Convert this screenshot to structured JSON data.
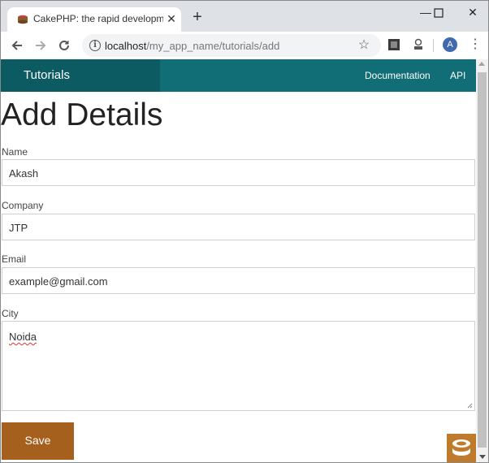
{
  "browser": {
    "tab_title": "CakePHP: the rapid development",
    "url_host": "localhost",
    "url_path": "/my_app_name/tutorials/add",
    "profile_initial": "A",
    "icons": {
      "favicon": "cakephp-favicon",
      "close": "close-icon",
      "new_tab": "plus-icon",
      "back": "back-arrow-icon",
      "forward": "forward-arrow-icon",
      "reload": "reload-icon",
      "info": "info-icon",
      "bookmark": "star-icon",
      "menu": "kebab-menu-icon"
    }
  },
  "nav": {
    "brand": "Tutorials",
    "links": [
      "Documentation",
      "API"
    ]
  },
  "page": {
    "heading": "Add Details",
    "fields": [
      {
        "label": "Name",
        "value": "Akash"
      },
      {
        "label": "Company",
        "value": "JTP"
      },
      {
        "label": "Email",
        "value": "example@gmail.com"
      },
      {
        "label": "City",
        "value": "Noida"
      }
    ],
    "save_label": "Save"
  },
  "colors": {
    "nav_bar": "#116d76",
    "brand_bg": "#0c5a62",
    "save_button": "#a6601e",
    "logo_bg": "#c07a2b"
  }
}
